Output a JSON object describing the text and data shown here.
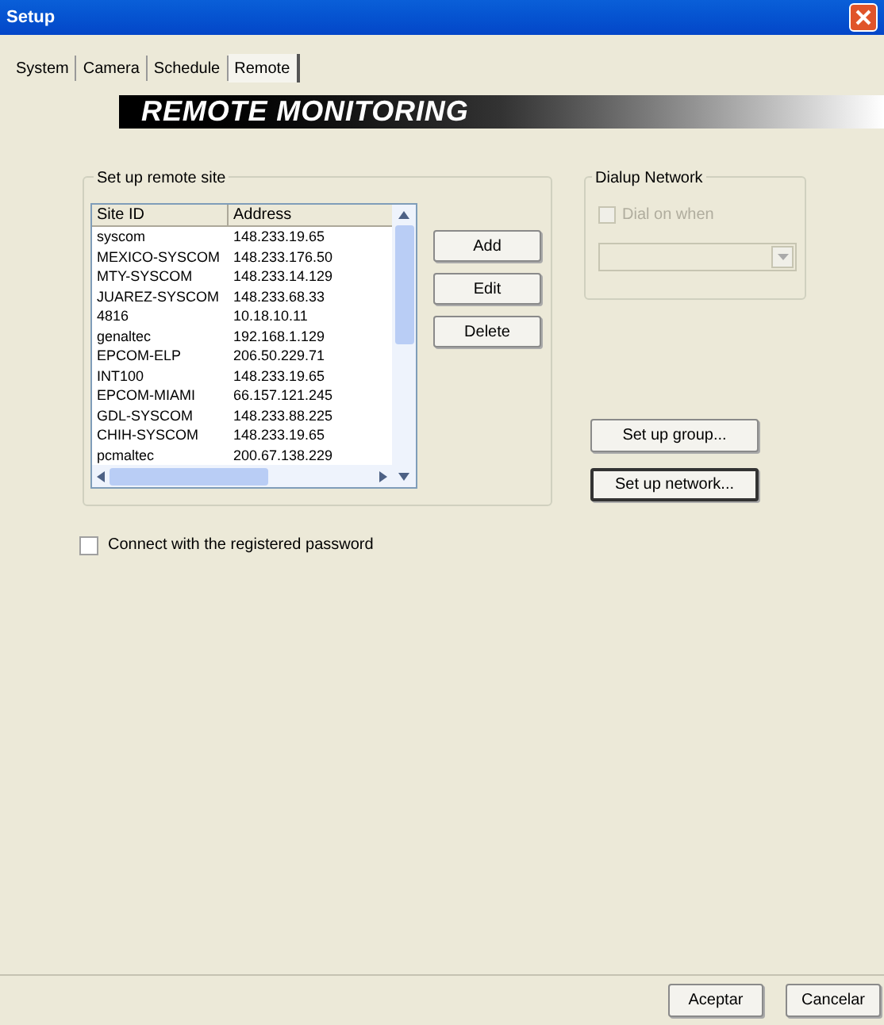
{
  "window": {
    "title": "Setup"
  },
  "tabs": [
    {
      "label": "System",
      "selected": false
    },
    {
      "label": "Camera",
      "selected": false
    },
    {
      "label": "Schedule",
      "selected": false
    },
    {
      "label": "Remote",
      "selected": true
    }
  ],
  "banner": "REMOTE MONITORING",
  "remote_site": {
    "title": "Set up remote site",
    "columns": [
      "Site ID",
      "Address"
    ],
    "rows": [
      [
        "syscom",
        "148.233.19.65"
      ],
      [
        "MEXICO-SYSCOM",
        "148.233.176.50"
      ],
      [
        "MTY-SYSCOM",
        "148.233.14.129"
      ],
      [
        "JUAREZ-SYSCOM",
        "148.233.68.33"
      ],
      [
        "4816",
        "10.18.10.11"
      ],
      [
        "genaltec",
        "192.168.1.129"
      ],
      [
        "EPCOM-ELP",
        "206.50.229.71"
      ],
      [
        "INT100",
        "148.233.19.65"
      ],
      [
        "EPCOM-MIAMI",
        "66.157.121.245"
      ],
      [
        "GDL-SYSCOM",
        "148.233.88.225"
      ],
      [
        "CHIH-SYSCOM",
        "148.233.19.65"
      ],
      [
        "pcmaltec",
        "200.67.138.229"
      ]
    ],
    "buttons": [
      "Add",
      "Edit",
      "Delete"
    ]
  },
  "dialup": {
    "title": "Dialup Network",
    "checkbox": {
      "label": "Dial on when",
      "checked": false,
      "disabled": true
    },
    "combo_disabled": true
  },
  "group_buttons": [
    {
      "label": "Set up group...",
      "focused": false
    },
    {
      "label": "Set up network...",
      "focused": true
    }
  ],
  "password_checkbox": {
    "label": "Connect with the registered password",
    "checked": false
  },
  "footer_buttons": [
    "Aceptar",
    "Cancelar"
  ]
}
